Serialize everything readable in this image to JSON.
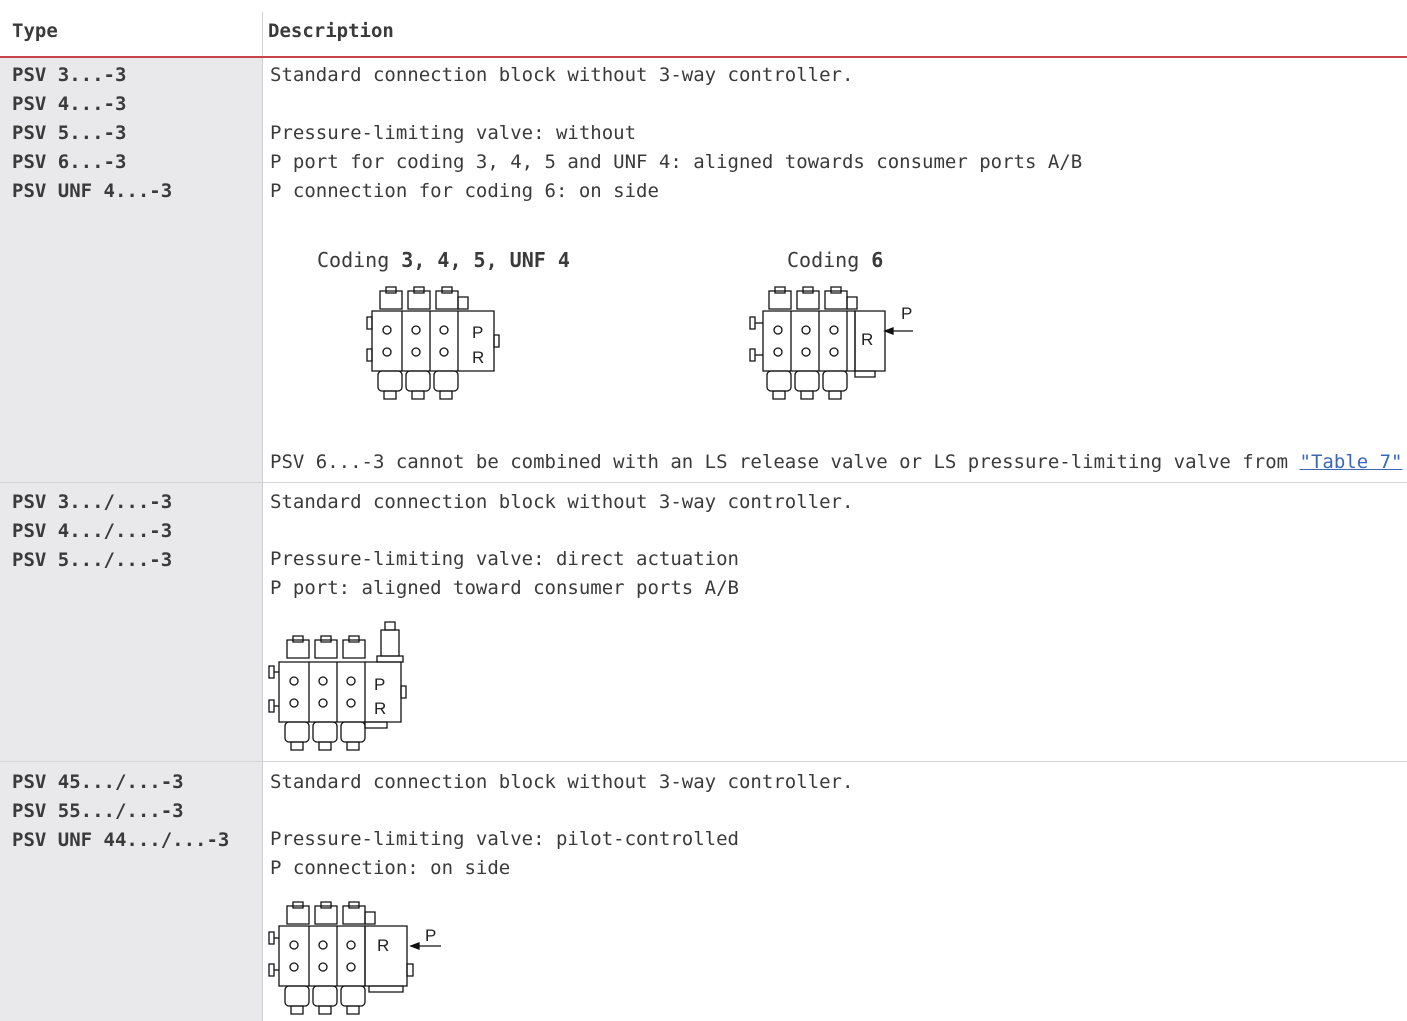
{
  "header": {
    "type_label": "Type",
    "description_label": "Description"
  },
  "rows": [
    {
      "types": [
        "PSV 3...-3",
        "PSV 4...-3",
        "PSV 5...-3",
        "PSV 6...-3",
        "PSV UNF 4...-3"
      ],
      "lines": [
        "Standard connection block without 3-way controller.",
        "Pressure-limiting valve: without",
        "P port for coding 3, 4, 5 and UNF 4: aligned towards consumer ports A/B",
        "P connection for coding 6: on side"
      ],
      "figures": {
        "left_caption_prefix": "Coding ",
        "left_caption_bold": "3, 4, 5, UNF 4",
        "right_caption_prefix": "Coding ",
        "right_caption_bold": "6",
        "left_labels": [
          "P",
          "R"
        ],
        "right_labels": [
          "R",
          "P"
        ]
      },
      "note_prefix": "PSV 6...-3 cannot be combined with an LS release valve or LS pressure-limiting valve from ",
      "note_link": "\"Table 7\"",
      "note_suffix": " ."
    },
    {
      "types": [
        "PSV 3.../...-3",
        "PSV 4.../...-3",
        "PSV 5.../...-3"
      ],
      "lines": [
        "Standard connection block without 3-way controller.",
        "Pressure-limiting valve: direct actuation",
        "P port: aligned toward consumer ports A/B"
      ],
      "figure_labels": [
        "P",
        "R"
      ]
    },
    {
      "types": [
        "PSV 45.../...-3",
        "PSV 55.../...-3",
        "PSV UNF 44.../...-3"
      ],
      "lines": [
        "Standard connection block without 3-way controller.",
        "Pressure-limiting valve: pilot-controlled",
        "P connection: on side"
      ],
      "figure_labels": [
        "R",
        "P"
      ]
    }
  ]
}
